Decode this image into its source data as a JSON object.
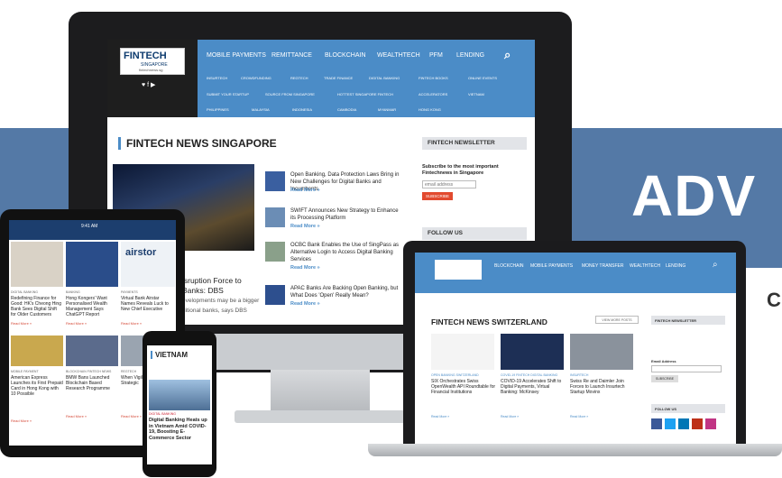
{
  "background": {
    "banner_text": "ADV",
    "side_char": "C",
    "band_color": "#5479a6"
  },
  "monitor": {
    "logo": {
      "title": "FINTECH",
      "subtitle": "SINGAPORE",
      "url": "fintechnews.sg"
    },
    "social": "♥ f ▶",
    "nav_primary": [
      "MOBILE PAYMENTS",
      "REMITTANCE",
      "BLOCKCHAIN",
      "WEALTHTECH",
      "PFM",
      "LENDING"
    ],
    "nav_secondary_1": [
      "INSURTECH",
      "CROWDFUNDING",
      "REGTECH",
      "TRADE FINANCE",
      "DIGITAL BANKING",
      "FINTECH BOOKS",
      "ONLINE EVENTS"
    ],
    "nav_secondary_2": [
      "SUBMIT YOUR STARTUP",
      "SOURCE FROM SINGAPORE",
      "HOTTEST SINGAPORE FINTECH",
      "ACCELERATORS",
      "VIETNAM"
    ],
    "nav_secondary_3": [
      "PHILIPPINES",
      "MALAYSIA",
      "INDONESIA",
      "CAMBODIA",
      "MYANMAR",
      "HONG KONG"
    ],
    "section_title": "FINTECH NEWS SINGAPORE",
    "hero_caption_1": "isruption Force to",
    "hero_caption_2": "Banks: DBS",
    "hero_caption_3": "evelopments may be a bigger",
    "hero_caption_4": "ditional banks, says DBS",
    "articles": [
      {
        "title": "Open Banking, Data Protection Laws Bring in New Challenges for Digital Banks and Incumbents",
        "more": "Read More »"
      },
      {
        "title": "SWIFT Announces New Strategy to Enhance its Processing Platform",
        "more": "Read More »"
      },
      {
        "title": "OCBC Bank Enables the Use of SingPass as Alternative Login to Access Digital Banking Services",
        "more": "Read More »"
      },
      {
        "title": "APAC Banks Are Backing Open Banking, but What Does 'Open' Really Mean?",
        "more": "Read More »"
      }
    ],
    "newsletter_head": "FINTECH NEWSLETTER",
    "newsletter_text": "Subscribe to the most important Fintechnews in Singapore",
    "email_placeholder": "email address",
    "subscribe_label": "SUBSCRIBE",
    "follow_head": "FOLLOW US"
  },
  "tablet": {
    "time": "9:41 AM",
    "brand": "airstor",
    "cols": [
      {
        "cat": "DIGITAL BANKING",
        "title": "Redefining Finance for Good: HK's Cheong Hing Bank Sees Digital Shift for Older Customers",
        "more": "Read More »"
      },
      {
        "cat": "BANKING",
        "title": "Hong Kongers' Want Personalised Wealth Management Says ChatGPT Report",
        "more": "Read More »"
      },
      {
        "cat": "PAYMENTS",
        "title": "Virtual Bank Airstar Names Reveals Luck to New Chief Executive",
        "more": "Read More »"
      }
    ],
    "cols2": [
      {
        "cat": "MOBILE PAYMENT",
        "title": "American Express Launches its First Prepaid Card in Hong Kong with 10 Possible",
        "more": "Read More »"
      },
      {
        "cat": "BLOCKCHAIN FINTECH NEWS",
        "title": "BMW Bans Launched Blockchain Based Research Programme",
        "more": "Read More »"
      },
      {
        "cat": "REGTECH",
        "title": "When Vigilant at the Helm Strategic",
        "more": "Read More »"
      }
    ]
  },
  "phone": {
    "title": "VIETNAM",
    "cat": "DIGITAL BANKING",
    "headline": "Digital Banking Heats up in Vietnam Amid COVID-19, Boosting E-Commerce Sector"
  },
  "laptop": {
    "nav_primary": [
      "BLOCKCHAIN",
      "MOBILE PAYMENTS",
      "MONEY TRANSFER",
      "WEALTHTECH",
      "LENDING"
    ],
    "section_title": "FINTECH NEWS SWITZERLAND",
    "view_more": "VIEW MORE POSTS",
    "cards": [
      {
        "cat": "OPEN BANKING SWITZERLAND",
        "title": "SIX Orchestrates Swiss OpenWealth API Roundtable for Financial Institutions",
        "more": "Read More »"
      },
      {
        "cat": "COVID-19 FINTECH DIGITAL BANKING",
        "title": "COVID-19 Accelerates Shift to Digital Payments, Virtual Banking: McKinsey",
        "more": "Read More »"
      },
      {
        "cat": "INSURTECH",
        "title": "Swiss Re and Daimler Join Forces to Launch Insurtech Startup Movinx",
        "more": "Read More »"
      }
    ],
    "newsletter_head": "FINTECH NEWSLETTER",
    "email_label": "Email Address",
    "subscribe_label": "SUBSCRIBE",
    "follow_head": "FOLLOW US"
  }
}
